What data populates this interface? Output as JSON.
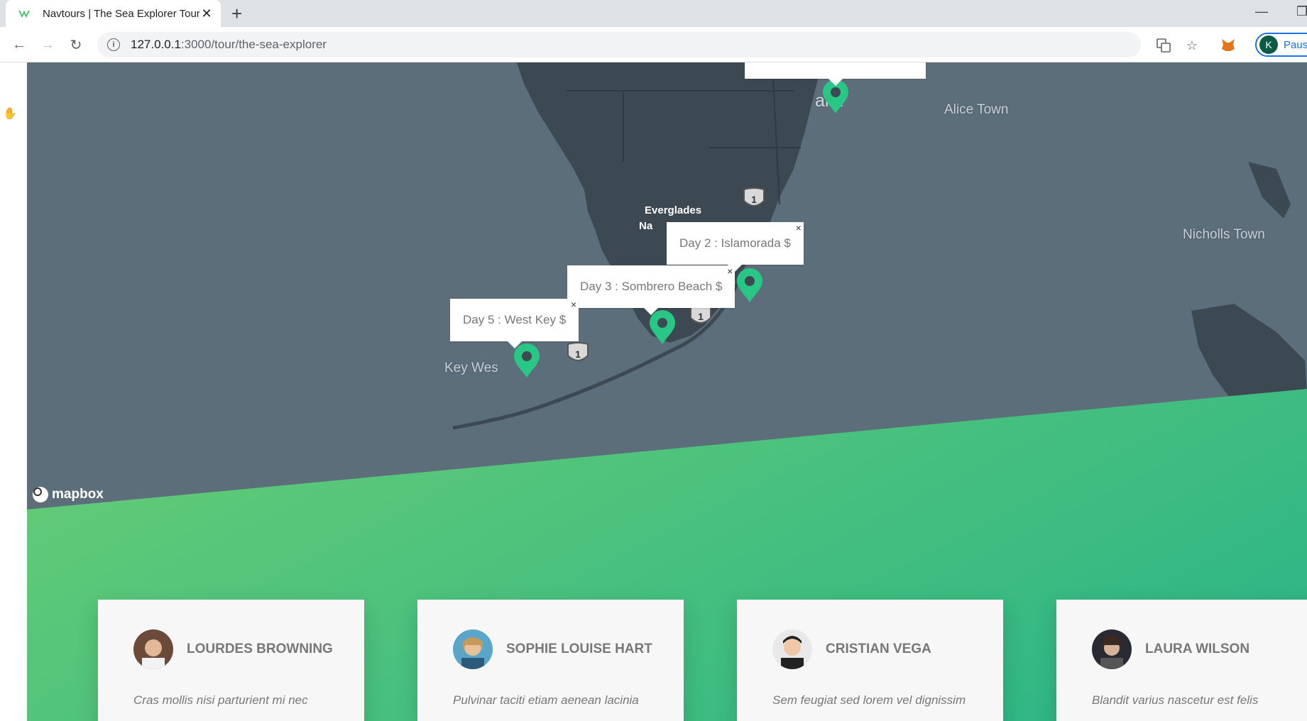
{
  "browser": {
    "tab_title": "Navtours | The Sea Explorer Tour",
    "url_host": "127.0.0.1",
    "url_path": ":3000/tour/the-sea-explorer",
    "profile_initial": "K",
    "profile_label": "Paus"
  },
  "map": {
    "places": {
      "miami": "ami",
      "alice_town": "Alice Town",
      "nicholls_town": "Nicholls Town",
      "everglades": "Everglades",
      "everglades_2": "Na",
      "key_west": "Key Wes"
    },
    "highway_label": "1",
    "popups": {
      "day2": "Day 2 : Islamorada $",
      "day3": "Day 3 : Sombrero Beach $",
      "day5": "Day 5 : West Key $"
    },
    "popup_close": "×",
    "attribution": "mapbox"
  },
  "reviews": [
    {
      "name": "Lourdes Browning",
      "text": "Cras mollis nisi parturient mi nec"
    },
    {
      "name": "Sophie Louise Hart",
      "text": "Pulvinar taciti etiam aenean lacinia"
    },
    {
      "name": "Cristian Vega",
      "text": "Sem feugiat sed lorem vel dignissim"
    },
    {
      "name": "Laura Wilson",
      "text": "Blandit varius nascetur est felis"
    }
  ],
  "colors": {
    "brand_green": "#55c57a",
    "map_water": "#5d6e7b",
    "map_land": "#3c4953"
  }
}
